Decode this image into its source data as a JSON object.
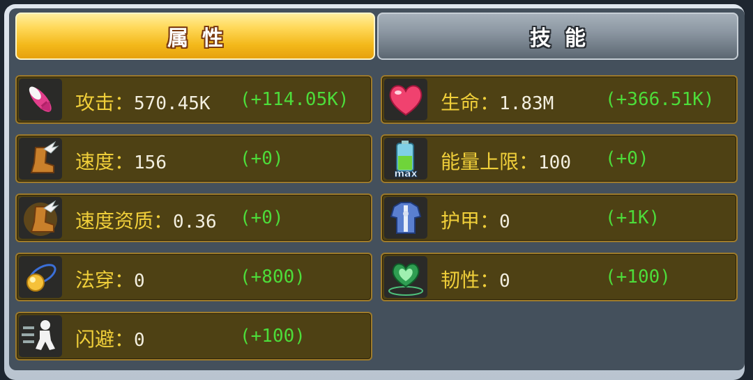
{
  "tabs": [
    {
      "label": "属性",
      "active": true
    },
    {
      "label": "技能",
      "active": false
    }
  ],
  "colors": {
    "label": "#f0cf3a",
    "value": "#f3efe0",
    "bonus": "#4ddc3a",
    "card_bg": "#4e4114",
    "card_border": "#9e7b2b"
  },
  "stats": [
    {
      "icon": "rocket-icon",
      "label": "攻击：",
      "value": "570.45K",
      "bonus": "(+114.05K)"
    },
    {
      "icon": "heart-icon",
      "label": "生命：",
      "value": "1.83M",
      "bonus": "(+366.51K)"
    },
    {
      "icon": "winged-boot-icon",
      "label": "速度：",
      "value": "156",
      "bonus": "(+0)"
    },
    {
      "icon": "battery-max-icon",
      "label": "能量上限：",
      "value": "100",
      "bonus": "(+0)"
    },
    {
      "icon": "winged-boot-glow-icon",
      "label": "速度资质：",
      "value": "0.36",
      "bonus": "(+0)"
    },
    {
      "icon": "armor-icon",
      "label": "护甲：",
      "value": "0",
      "bonus": "(+1K)"
    },
    {
      "icon": "magic-orb-icon",
      "label": "法穿：",
      "value": "0",
      "bonus": "(+800)"
    },
    {
      "icon": "green-heart-icon",
      "label": "韧性：",
      "value": "0",
      "bonus": "(+100)"
    },
    {
      "icon": "dodge-runner-icon",
      "label": "闪避：",
      "value": "0",
      "bonus": "(+100)"
    }
  ]
}
